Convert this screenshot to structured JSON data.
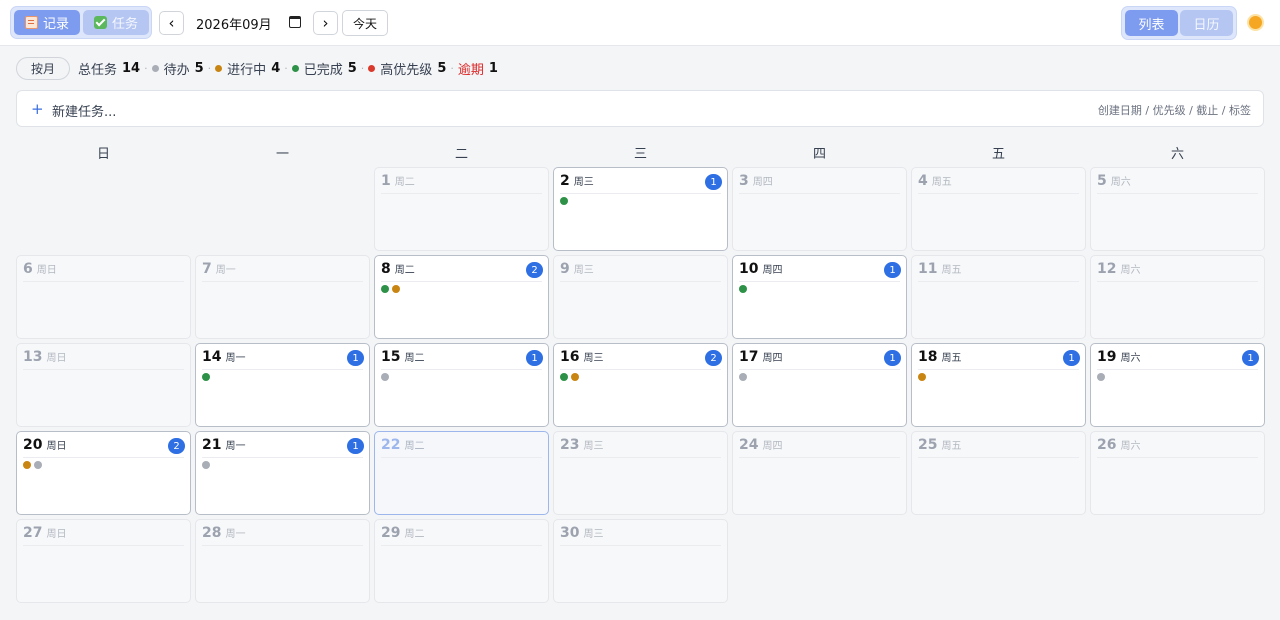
{
  "toolbar": {
    "record_label": "记录",
    "task_label": "任务",
    "prev_label": "‹",
    "next_label": "›",
    "month_value": "2026年09月",
    "today_label": "今天",
    "list_label": "列表",
    "calendar_label": "日历",
    "icons": {
      "record": "document-icon",
      "task": "checkbox-icon",
      "month_picker": "calendar-icon",
      "theme": "sun-icon"
    }
  },
  "stats": {
    "range_label": "按月",
    "total_label": "总任务",
    "total": "14",
    "todo_label": "待办",
    "todo": "5",
    "doing_label": "进行中",
    "doing": "4",
    "done_label": "已完成",
    "done": "5",
    "high_label": "高优先级",
    "high": "5",
    "overdue_label": "逾期",
    "overdue": "1"
  },
  "new_task": {
    "plus": "+",
    "placeholder": "新建任务...",
    "hint": "创建日期 / 优先级 / 截止 / 标签"
  },
  "colors": {
    "accent": "#2f6fe4",
    "todo": "#a8adb6",
    "doing": "#c98512",
    "done": "#2e9148",
    "high": "#d93a2b",
    "overdue": "#dc2626"
  },
  "weekdays": [
    "日",
    "一",
    "二",
    "三",
    "四",
    "五",
    "六"
  ],
  "days": [
    {
      "d": "1",
      "wd": "周二",
      "count": "",
      "dots": []
    },
    {
      "d": "2",
      "wd": "周三",
      "count": "1",
      "dots": [
        "done"
      ]
    },
    {
      "d": "3",
      "wd": "周四",
      "count": "",
      "dots": []
    },
    {
      "d": "4",
      "wd": "周五",
      "count": "",
      "dots": []
    },
    {
      "d": "5",
      "wd": "周六",
      "count": "",
      "dots": []
    },
    {
      "d": "6",
      "wd": "周日",
      "count": "",
      "dots": []
    },
    {
      "d": "7",
      "wd": "周一",
      "count": "",
      "dots": []
    },
    {
      "d": "8",
      "wd": "周二",
      "count": "2",
      "dots": [
        "done",
        "doing"
      ]
    },
    {
      "d": "9",
      "wd": "周三",
      "count": "",
      "dots": []
    },
    {
      "d": "10",
      "wd": "周四",
      "count": "1",
      "dots": [
        "done"
      ]
    },
    {
      "d": "11",
      "wd": "周五",
      "count": "",
      "dots": []
    },
    {
      "d": "12",
      "wd": "周六",
      "count": "",
      "dots": []
    },
    {
      "d": "13",
      "wd": "周日",
      "count": "",
      "dots": []
    },
    {
      "d": "14",
      "wd": "周一",
      "count": "1",
      "dots": [
        "done"
      ]
    },
    {
      "d": "15",
      "wd": "周二",
      "count": "1",
      "dots": [
        "todo"
      ]
    },
    {
      "d": "16",
      "wd": "周三",
      "count": "2",
      "dots": [
        "done",
        "doing"
      ]
    },
    {
      "d": "17",
      "wd": "周四",
      "count": "1",
      "dots": [
        "todo"
      ]
    },
    {
      "d": "18",
      "wd": "周五",
      "count": "1",
      "dots": [
        "doing"
      ]
    },
    {
      "d": "19",
      "wd": "周六",
      "count": "1",
      "dots": [
        "todo"
      ]
    },
    {
      "d": "20",
      "wd": "周日",
      "count": "2",
      "dots": [
        "doing",
        "todo"
      ]
    },
    {
      "d": "21",
      "wd": "周一",
      "count": "1",
      "dots": [
        "todo"
      ]
    },
    {
      "d": "22",
      "wd": "周二",
      "count": "",
      "dots": [],
      "today": true
    },
    {
      "d": "23",
      "wd": "周三",
      "count": "",
      "dots": []
    },
    {
      "d": "24",
      "wd": "周四",
      "count": "",
      "dots": []
    },
    {
      "d": "25",
      "wd": "周五",
      "count": "",
      "dots": []
    },
    {
      "d": "26",
      "wd": "周六",
      "count": "",
      "dots": []
    },
    {
      "d": "27",
      "wd": "周日",
      "count": "",
      "dots": []
    },
    {
      "d": "28",
      "wd": "周一",
      "count": "",
      "dots": []
    },
    {
      "d": "29",
      "wd": "周二",
      "count": "",
      "dots": []
    },
    {
      "d": "30",
      "wd": "周三",
      "count": "",
      "dots": []
    }
  ]
}
